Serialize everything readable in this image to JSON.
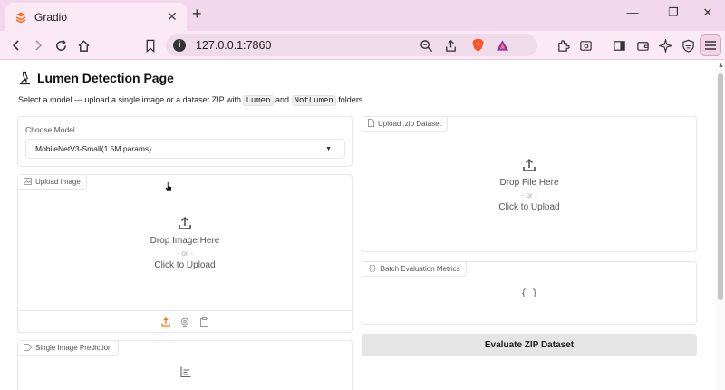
{
  "browser": {
    "tab_title": "Gradio",
    "tab_close": "✕",
    "new_tab": "+",
    "url": "127.0.0.1:7860"
  },
  "page": {
    "title": "Lumen Detection Page",
    "subtitle_before": "Select a model --- upload a single image or a dataset ZIP with",
    "code_lumen": "Lumen",
    "subtitle_and": "and",
    "code_notlumen": "NotLumen",
    "subtitle_after": "folders."
  },
  "model": {
    "label": "Choose Model",
    "selected": "MobileNetV3-Small(1.5M params)"
  },
  "upload_image": {
    "label": "Upload Image",
    "drop_text": "Drop Image Here",
    "or_text": "- or -",
    "click_text": "Click to Upload"
  },
  "single_prediction": {
    "label": "Single Image Prediction"
  },
  "upload_zip": {
    "label": "Upload .zip Dataset",
    "drop_text": "Drop File Here",
    "or_text": "- or -",
    "click_text": "Click to Upload"
  },
  "metrics": {
    "label": "Batch Evaluation Metrics",
    "empty_json": "{ }"
  },
  "evaluate_button": "Evaluate ZIP Dataset",
  "colors": {
    "tab_strip": "#f3d7ea",
    "toolbar": "#fbeaf5",
    "button_bg": "#e5e5e5",
    "upload_accent": "#f97316"
  }
}
